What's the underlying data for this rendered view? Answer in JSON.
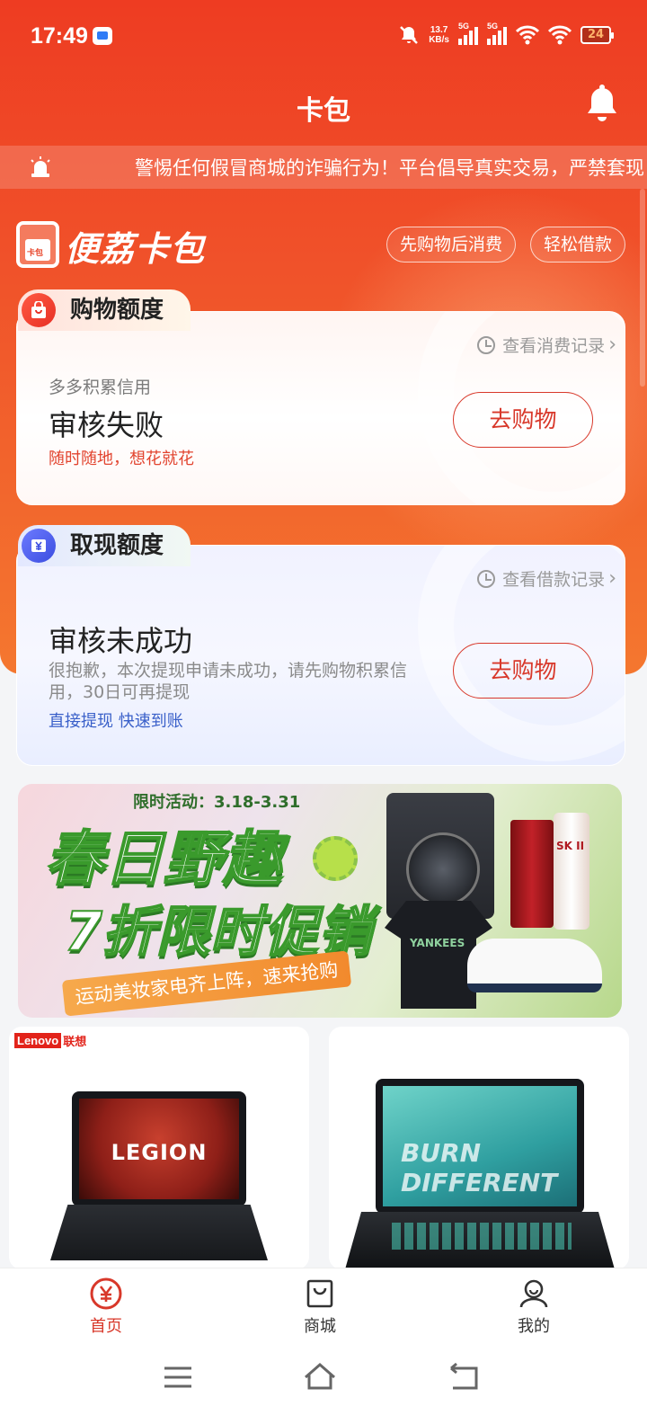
{
  "status_bar": {
    "time": "17:49",
    "net_speed_value": "13.7",
    "net_speed_unit": "KB/s",
    "signal1_label": "5G",
    "signal2_label": "5G",
    "battery": "24"
  },
  "header": {
    "title": "卡包"
  },
  "notice": {
    "text": "警惕任何假冒商城的诈骗行为！平台倡导真实交易，严禁套现"
  },
  "brand": {
    "name": "便荔卡包",
    "card_text": "卡包",
    "pill1": "先购物后消费",
    "pill2": "轻松借款"
  },
  "shopping": {
    "tab_label": "购物额度",
    "record_link": "查看消费记录",
    "small_label": "多多积累信用",
    "status": "审核失败",
    "subtitle": "随时随地，想花就花",
    "button": "去购物"
  },
  "cash": {
    "tab_label": "取现额度",
    "record_link": "查看借款记录",
    "status": "审核未成功",
    "description": "很抱歉，本次提现申请未成功，请先购物积累信用，30日可再提现",
    "subtitle": "直接提现 快速到账",
    "button": "去购物"
  },
  "banner": {
    "tag": "限时活动：3.18-3.31",
    "headline1": "春日野趣",
    "headline2": "7折限时促销",
    "ribbon": "运动美妆家电齐上阵，速来抢购",
    "shirt_text": "YANKEES",
    "bottle_text": "SK II"
  },
  "products": [
    {
      "brand_en": "Lenovo",
      "brand_cn": "联想",
      "screen_text": "LEGION"
    },
    {
      "screen_text": "BURN DIFFERENT"
    }
  ],
  "tabbar": {
    "items": [
      {
        "label": "首页",
        "icon": "yuan-icon",
        "active": true
      },
      {
        "label": "商城",
        "icon": "shop-bag-icon",
        "active": false
      },
      {
        "label": "我的",
        "icon": "user-icon",
        "active": false
      }
    ]
  },
  "colors": {
    "primary": "#ee3c22",
    "accent_red": "#d8382a",
    "link_blue": "#3a60c9"
  }
}
